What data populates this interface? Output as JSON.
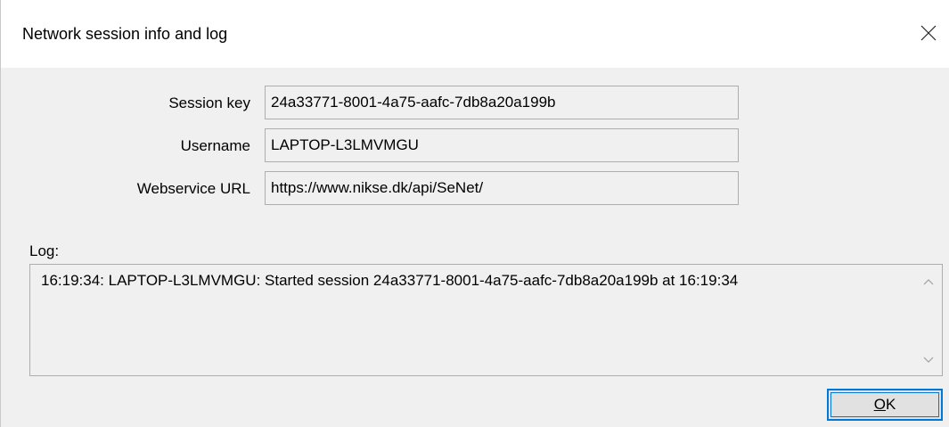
{
  "window": {
    "title": "Network session info and log",
    "close_symbol": "×"
  },
  "fields": {
    "session_key": {
      "label": "Session key",
      "value": "24a33771-8001-4a75-aafc-7db8a20a199b"
    },
    "username": {
      "label": "Username",
      "value": "LAPTOP-L3LMVMGU"
    },
    "webservice_url": {
      "label": "Webservice URL",
      "value": "https://www.nikse.dk/api/SeNet/"
    }
  },
  "log": {
    "label": "Log:",
    "text": "16:19:34: LAPTOP-L3LMVMGU: Started session 24a33771-8001-4a75-aafc-7db8a20a199b at 16:19:34"
  },
  "buttons": {
    "ok_first": "O",
    "ok_rest": "K"
  },
  "icons": {
    "close": "close-icon",
    "scroll_up": "chevron-up-icon",
    "scroll_down": "chevron-down-icon"
  },
  "colors": {
    "dialog_bg": "#f0f0f0",
    "titlebar_bg": "#ffffff",
    "accent": "#0078d7",
    "field_border": "#adadad"
  }
}
